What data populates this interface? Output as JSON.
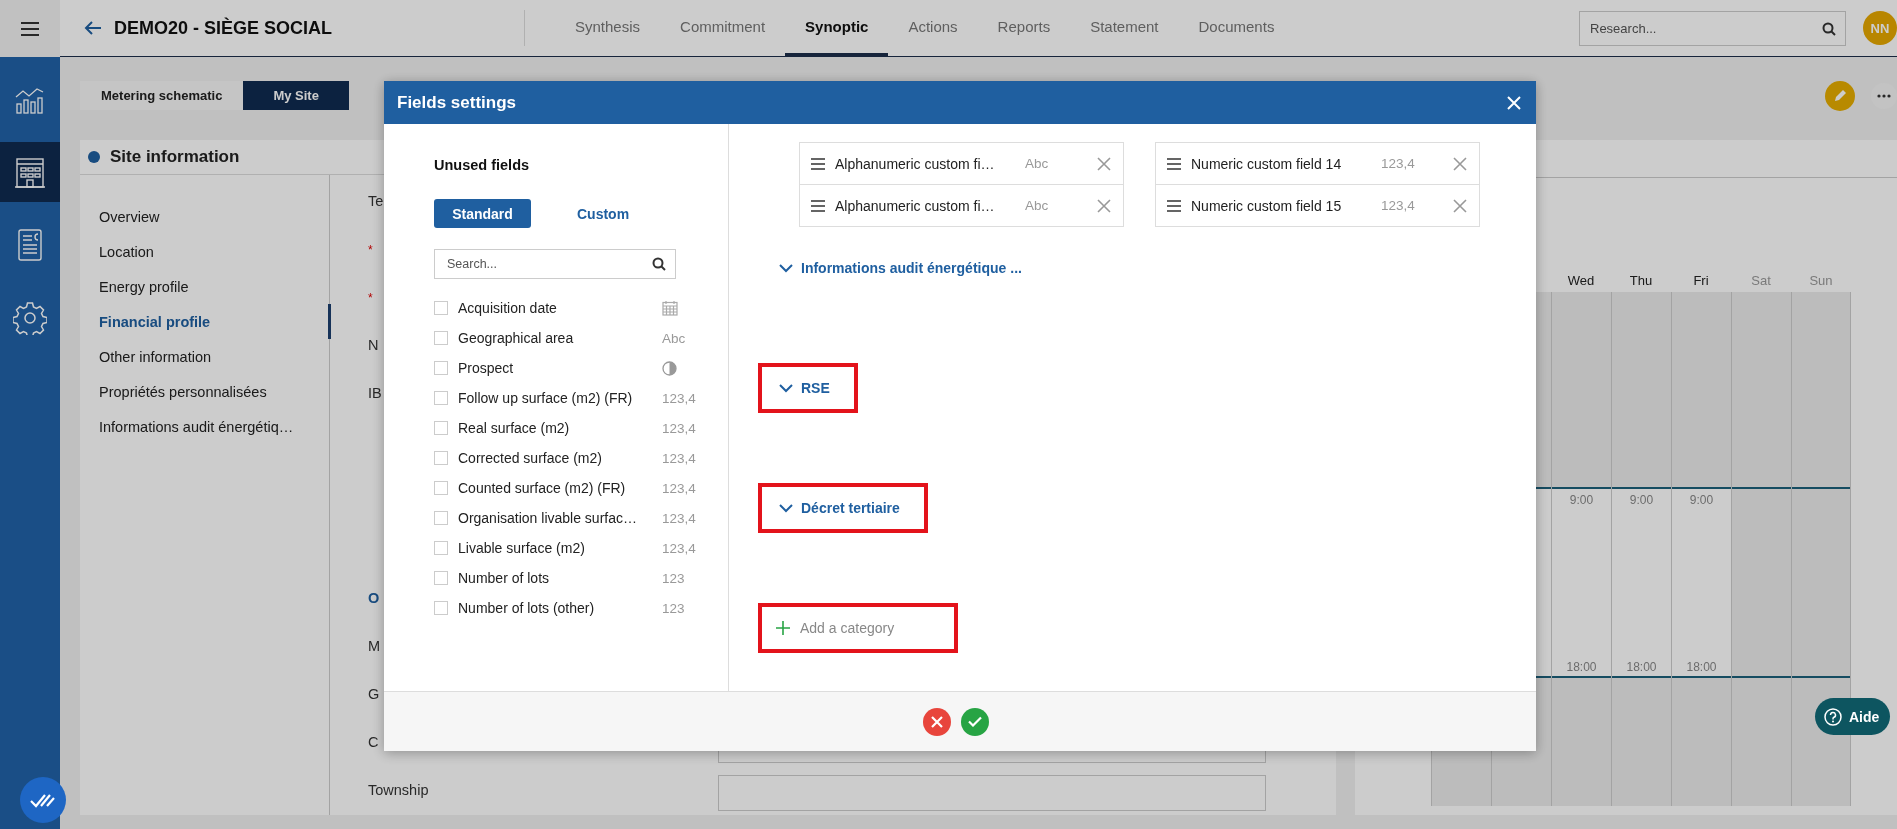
{
  "sidebar": {
    "items": [
      {
        "selected": false
      },
      {
        "selected": true
      },
      {
        "selected": false
      },
      {
        "selected": false
      }
    ]
  },
  "header": {
    "title": "DEMO20 - SIÈGE SOCIAL",
    "tabs": [
      {
        "label": "Synthesis",
        "selected": false
      },
      {
        "label": "Commitment",
        "selected": false
      },
      {
        "label": "Synoptic",
        "selected": true
      },
      {
        "label": "Actions",
        "selected": false
      },
      {
        "label": "Reports",
        "selected": false
      },
      {
        "label": "Statement",
        "selected": false
      },
      {
        "label": "Documents",
        "selected": false
      }
    ],
    "search": {
      "placeholder": "Research..."
    },
    "avatar": "NN"
  },
  "view_tabs": [
    {
      "label": "Metering schematic",
      "selected": false
    },
    {
      "label": "My Site",
      "selected": true
    }
  ],
  "site_panel": {
    "title": "Site information",
    "nav": [
      {
        "label": "Overview",
        "selected": false
      },
      {
        "label": "Location",
        "selected": false
      },
      {
        "label": "Energy profile",
        "selected": false
      },
      {
        "label": "Financial profile",
        "selected": true
      },
      {
        "label": "Other information",
        "selected": false
      },
      {
        "label": "Propriétés personnalisées",
        "selected": false
      },
      {
        "label": "Informations audit énergétiq…",
        "selected": false
      }
    ],
    "form": [
      {
        "kind": "label",
        "label": "Te"
      },
      {
        "kind": "label",
        "star": "*"
      },
      {
        "kind": "label",
        "star": "*"
      },
      {
        "kind": "label",
        "label": "N"
      },
      {
        "kind": "label",
        "label": "IB"
      },
      {
        "kind": "section",
        "label": "O"
      },
      {
        "kind": "label",
        "label": "M"
      },
      {
        "kind": "label",
        "label": "G"
      },
      {
        "kind": "input",
        "label": "C"
      },
      {
        "kind": "input",
        "label": "Township"
      }
    ]
  },
  "schedule": {
    "days": [
      {
        "label": "Wed",
        "weekend": false,
        "open": "9:00",
        "close": "18:00"
      },
      {
        "label": "Thu",
        "weekend": false,
        "open": "9:00",
        "close": "18:00"
      },
      {
        "label": "Fri",
        "weekend": false,
        "open": "9:00",
        "close": "18:00"
      },
      {
        "label": "Sat",
        "weekend": true
      },
      {
        "label": "Sun",
        "weekend": true
      }
    ]
  },
  "modal": {
    "title": "Fields settings",
    "unused": {
      "title": "Unused fields",
      "tabs": [
        {
          "label": "Standard",
          "selected": true
        },
        {
          "label": "Custom",
          "selected": false
        }
      ],
      "search": {
        "placeholder": "Search..."
      },
      "fields": [
        {
          "label": "Acquisition date",
          "checked": false,
          "kind": "date"
        },
        {
          "label": "Geographical area",
          "checked": false,
          "kind": "value",
          "hint": "Abc"
        },
        {
          "label": "Prospect",
          "checked": false,
          "kind": "boolean"
        },
        {
          "label": "Follow up surface (m2) (FR)",
          "checked": false,
          "kind": "value",
          "hint": "123,4"
        },
        {
          "label": "Real surface (m2)",
          "checked": false,
          "kind": "value",
          "hint": "123,4"
        },
        {
          "label": "Corrected surface (m2)",
          "checked": false,
          "kind": "value",
          "hint": "123,4"
        },
        {
          "label": "Counted surface (m2) (FR)",
          "checked": false,
          "kind": "value",
          "hint": "123,4"
        },
        {
          "label": "Organisation livable surfac…",
          "checked": false,
          "kind": "value",
          "hint": "123,4"
        },
        {
          "label": "Livable surface (m2)",
          "checked": false,
          "kind": "value",
          "hint": "123,4"
        },
        {
          "label": "Number of lots",
          "checked": false,
          "kind": "value",
          "hint": "123"
        },
        {
          "label": "Number of lots (other)",
          "checked": false,
          "kind": "value",
          "hint": "123"
        }
      ]
    },
    "columns": [
      [
        {
          "label": "Alphanumeric custom fi…",
          "hint": "Abc"
        },
        {
          "label": "Alphanumeric custom fi…",
          "hint": "Abc"
        }
      ],
      [
        {
          "label": "Numeric custom field 14",
          "hint": "123,4"
        },
        {
          "label": "Numeric custom field 15",
          "hint": "123,4"
        }
      ]
    ],
    "categories": [
      {
        "label": "Informations audit énergétique ...",
        "highlighted": false
      },
      {
        "label": "RSE",
        "highlighted": true
      },
      {
        "label": "Décret tertiaire",
        "highlighted": true
      }
    ],
    "add_category": {
      "label": "Add a category",
      "highlighted": true
    }
  },
  "help": {
    "label": "Aide"
  }
}
